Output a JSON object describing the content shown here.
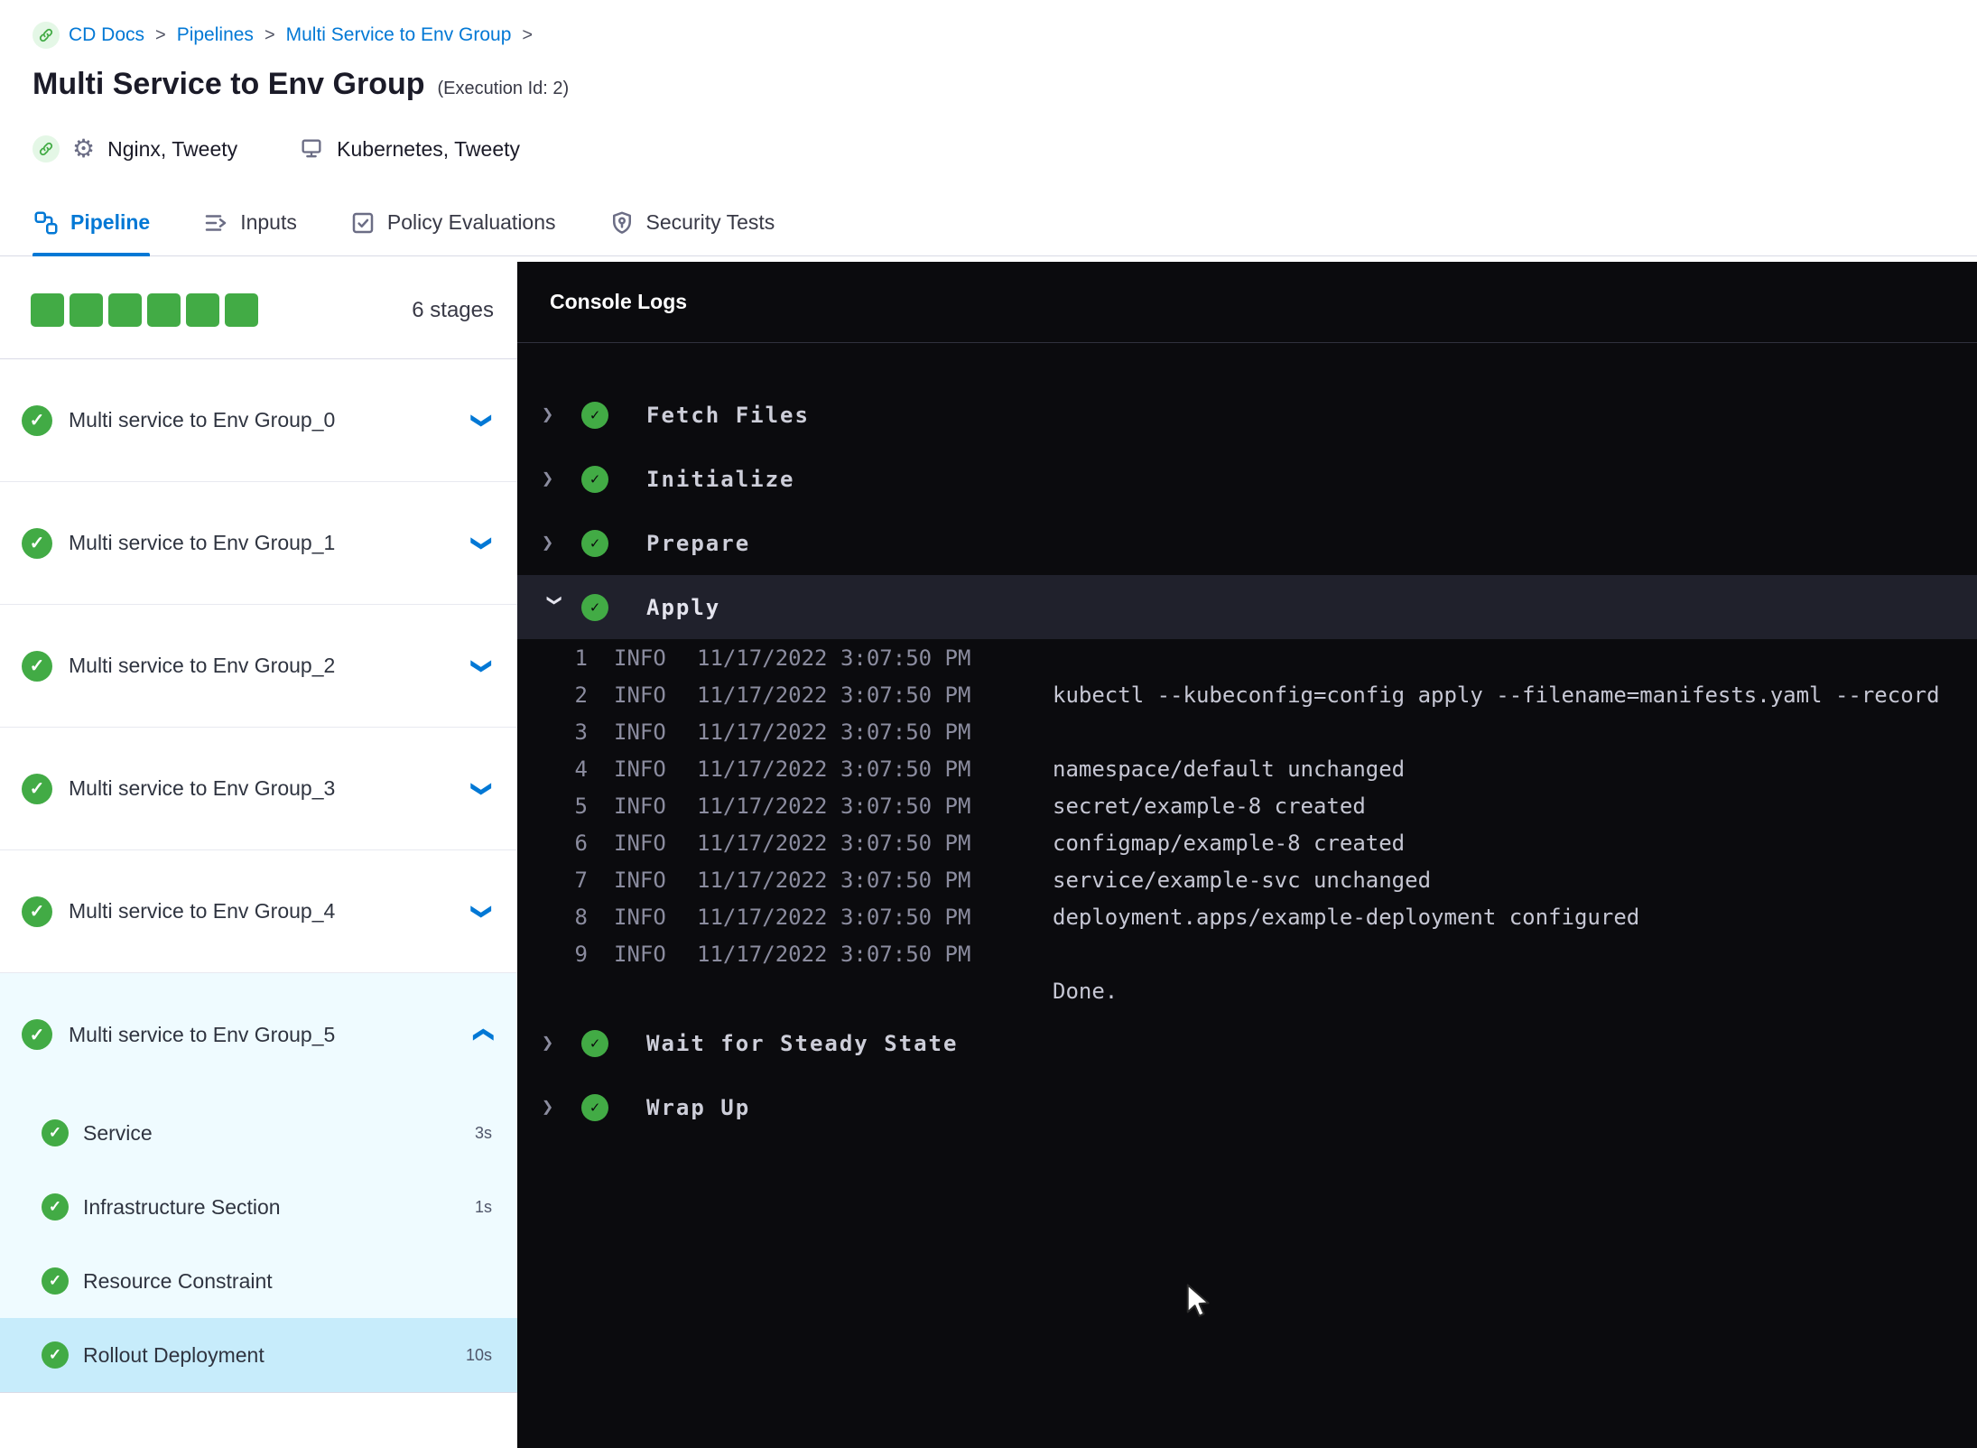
{
  "colors": {
    "accent_blue": "#0278d5",
    "success_green": "#42ab45",
    "console_bg": "#0b0b0e",
    "selected_step_bg": "#c7ecfb"
  },
  "icons": {
    "check": "✓",
    "chevron": "❯",
    "gear": "⚙",
    "separator": ">"
  },
  "breadcrumb": {
    "items": [
      {
        "label": "CD Docs"
      },
      {
        "label": "Pipelines"
      },
      {
        "label": "Multi Service to Env Group"
      }
    ]
  },
  "header": {
    "title": "Multi Service to Env Group",
    "execution_id": "(Execution Id: 2)",
    "services": "Nginx, Tweety",
    "environments": "Kubernetes, Tweety"
  },
  "tabs": [
    {
      "label": "Pipeline"
    },
    {
      "label": "Inputs"
    },
    {
      "label": "Policy Evaluations"
    },
    {
      "label": "Security Tests"
    }
  ],
  "sidebar": {
    "stages_summary": "6 stages",
    "stages": [
      {
        "name": "Multi service to Env Group_0"
      },
      {
        "name": "Multi service to Env Group_1"
      },
      {
        "name": "Multi service to Env Group_2"
      },
      {
        "name": "Multi service to Env Group_3"
      },
      {
        "name": "Multi service to Env Group_4"
      },
      {
        "name": "Multi service to Env Group_5",
        "steps": [
          {
            "name": "Service",
            "duration": "3s"
          },
          {
            "name": "Infrastructure Section",
            "duration": "1s"
          },
          {
            "name": "Resource Constraint",
            "duration": ""
          },
          {
            "name": "Rollout Deployment",
            "duration": "10s"
          }
        ]
      }
    ]
  },
  "console": {
    "title": "Console Logs",
    "steps": [
      {
        "name": "Fetch Files"
      },
      {
        "name": "Initialize"
      },
      {
        "name": "Prepare"
      },
      {
        "name": "Apply",
        "logs": [
          {
            "n": "1",
            "level": "INFO",
            "time": "11/17/2022 3:07:50 PM",
            "msg": ""
          },
          {
            "n": "2",
            "level": "INFO",
            "time": "11/17/2022 3:07:50 PM",
            "msg": "kubectl --kubeconfig=config apply --filename=manifests.yaml --record"
          },
          {
            "n": "3",
            "level": "INFO",
            "time": "11/17/2022 3:07:50 PM",
            "msg": ""
          },
          {
            "n": "4",
            "level": "INFO",
            "time": "11/17/2022 3:07:50 PM",
            "msg": "namespace/default unchanged"
          },
          {
            "n": "5",
            "level": "INFO",
            "time": "11/17/2022 3:07:50 PM",
            "msg": "secret/example-8 created"
          },
          {
            "n": "6",
            "level": "INFO",
            "time": "11/17/2022 3:07:50 PM",
            "msg": "configmap/example-8 created"
          },
          {
            "n": "7",
            "level": "INFO",
            "time": "11/17/2022 3:07:50 PM",
            "msg": "service/example-svc unchanged"
          },
          {
            "n": "8",
            "level": "INFO",
            "time": "11/17/2022 3:07:50 PM",
            "msg": "deployment.apps/example-deployment configured"
          },
          {
            "n": "9",
            "level": "INFO",
            "time": "11/17/2022 3:07:50 PM",
            "msg": ""
          }
        ],
        "footer": "Done."
      },
      {
        "name": "Wait for Steady State"
      },
      {
        "name": "Wrap Up"
      }
    ]
  }
}
